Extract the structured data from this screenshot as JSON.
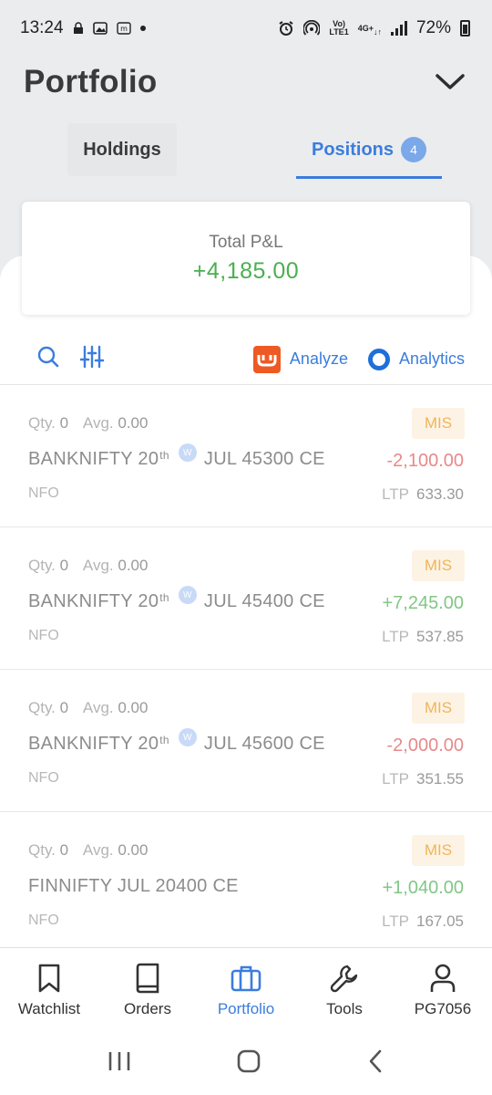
{
  "status_bar": {
    "time": "13:24",
    "battery": "72%",
    "network": "4G+",
    "volte": "VoLTE1"
  },
  "header": {
    "title": "Portfolio"
  },
  "tabs": [
    {
      "label": "Holdings"
    },
    {
      "label": "Positions",
      "badge": "4"
    }
  ],
  "summary": {
    "label": "Total P&L",
    "value": "+4,185.00"
  },
  "toolbar": {
    "analyze_label": "Analyze",
    "analytics_label": "Analytics"
  },
  "positions": [
    {
      "qty_label": "Qty.",
      "qty": "0",
      "avg_label": "Avg.",
      "avg": "0.00",
      "product": "MIS",
      "name_pre": "BANKNIFTY 20",
      "name_sup": "th",
      "weekly": "W",
      "name_post": "JUL 45300 CE",
      "pnl": "-2,100.00",
      "exchange": "NFO",
      "ltp_label": "LTP",
      "ltp": "633.30"
    },
    {
      "qty_label": "Qty.",
      "qty": "0",
      "avg_label": "Avg.",
      "avg": "0.00",
      "product": "MIS",
      "name_pre": "BANKNIFTY 20",
      "name_sup": "th",
      "weekly": "W",
      "name_post": "JUL 45400 CE",
      "pnl": "+7,245.00",
      "exchange": "NFO",
      "ltp_label": "LTP",
      "ltp": "537.85"
    },
    {
      "qty_label": "Qty.",
      "qty": "0",
      "avg_label": "Avg.",
      "avg": "0.00",
      "product": "MIS",
      "name_pre": "BANKNIFTY 20",
      "name_sup": "th",
      "weekly": "W",
      "name_post": "JUL 45600 CE",
      "pnl": "-2,000.00",
      "exchange": "NFO",
      "ltp_label": "LTP",
      "ltp": "351.55"
    },
    {
      "qty_label": "Qty.",
      "qty": "0",
      "avg_label": "Avg.",
      "avg": "0.00",
      "product": "MIS",
      "name_pre": "FINNIFTY JUL 20400 CE",
      "pnl": "+1,040.00",
      "exchange": "NFO",
      "ltp_label": "LTP",
      "ltp": "167.05"
    }
  ],
  "bottom_nav": [
    {
      "label": "Watchlist",
      "icon": "bookmark-icon"
    },
    {
      "label": "Orders",
      "icon": "book-icon"
    },
    {
      "label": "Portfolio",
      "icon": "briefcase-icon",
      "active": true
    },
    {
      "label": "Tools",
      "icon": "wrench-icon"
    },
    {
      "label": "PG7056",
      "icon": "user-icon"
    }
  ],
  "colors": {
    "accent": "#3b7ddd",
    "profit": "#4caf50",
    "loss": "#e8898a",
    "mis_badge": "#f0b45a"
  }
}
